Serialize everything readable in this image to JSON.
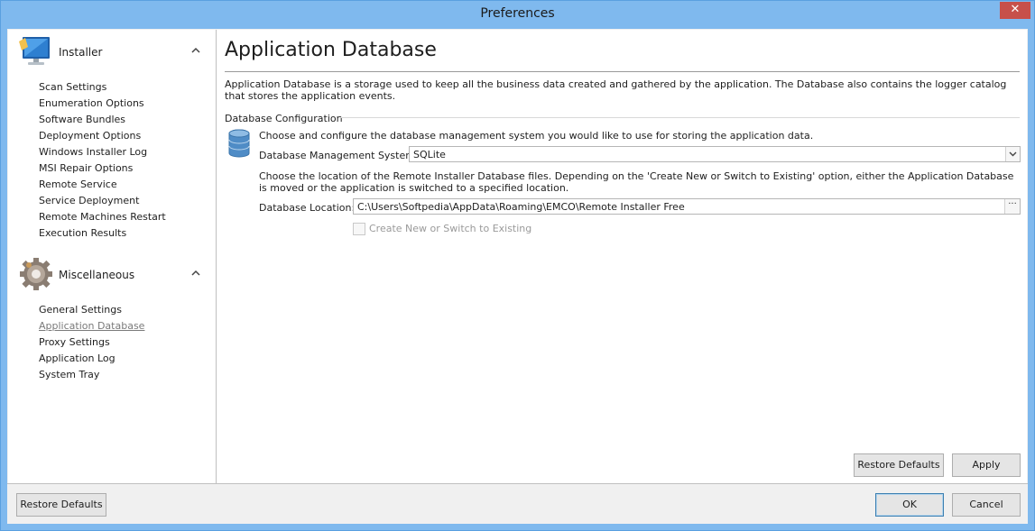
{
  "window": {
    "title": "Preferences",
    "close_glyph": "✕"
  },
  "sidebar": {
    "groups": [
      {
        "label": "Installer",
        "icon": "monitor-icon",
        "items": [
          "Scan Settings",
          "Enumeration Options",
          "Software Bundles",
          "Deployment Options",
          "Windows Installer Log",
          "MSI Repair Options",
          "Remote Service",
          "Service Deployment",
          "Remote Machines Restart",
          "Execution Results"
        ]
      },
      {
        "label": "Miscellaneous",
        "icon": "gear-icon",
        "items": [
          "General Settings",
          "Application Database",
          "Proxy Settings",
          "Application Log",
          "System Tray"
        ],
        "active_item": "Application Database"
      }
    ]
  },
  "content": {
    "title": "Application Database",
    "description": "Application Database is a storage used to keep all the business data created and gathered by the application. The Database also contains the logger catalog that stores the application events.",
    "section_label": "Database Configuration",
    "choose_text": "Choose and configure the database management system you would like to use for storing the application data.",
    "dbms_label": "Database Management System:",
    "dbms_value": "SQLite",
    "location_help": "Choose the location of the Remote Installer Database files. Depending on the 'Create New or Switch to Existing' option, either the Application Database is moved or the application is switched to a specified location.",
    "location_label": "Database Location:",
    "location_value": "C:\\Users\\Softpedia\\AppData\\Roaming\\EMCO\\Remote Installer Free",
    "ellipsis": "···",
    "create_checkbox_label": "Create New or Switch to Existing",
    "create_checkbox_checked": false,
    "restore_defaults": "Restore Defaults",
    "apply": "Apply"
  },
  "footer": {
    "restore_defaults": "Restore Defaults",
    "ok": "OK",
    "cancel": "Cancel"
  },
  "colors": {
    "titlebar": "#7fb9ee",
    "close_button": "#c7504a",
    "active_nav": "#7a7a7a"
  }
}
